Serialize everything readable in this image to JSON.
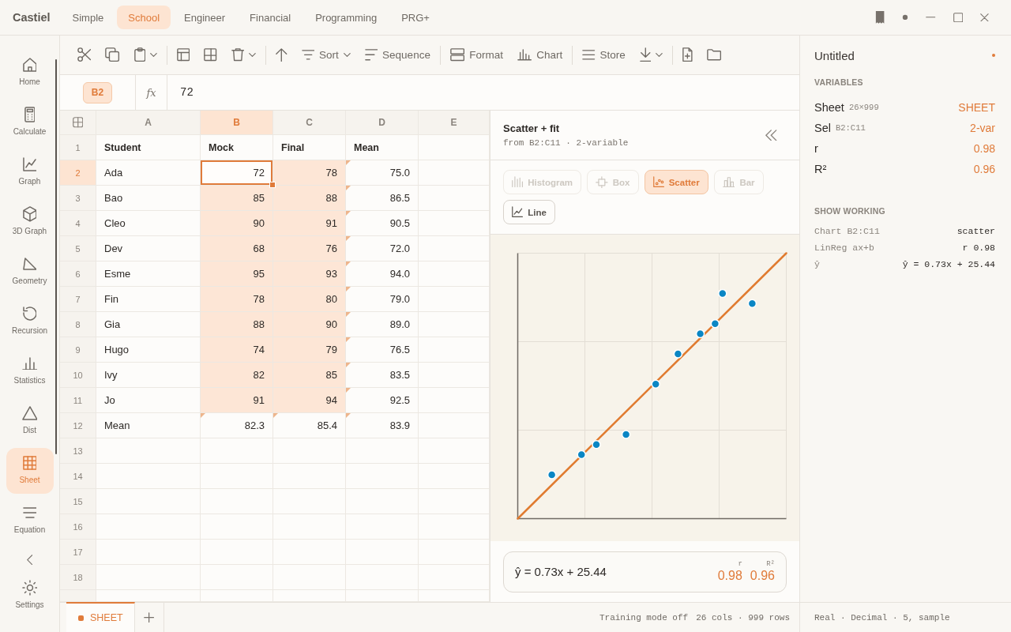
{
  "window": {
    "brand": "Castiel",
    "modes": [
      {
        "label": "Simple",
        "selected": false
      },
      {
        "label": "School",
        "selected": true
      },
      {
        "label": "Engineer",
        "selected": false
      },
      {
        "label": "Financial",
        "selected": false
      },
      {
        "label": "Programming",
        "selected": false
      },
      {
        "label": "PRG+",
        "selected": false
      }
    ]
  },
  "sidebar": {
    "items": [
      {
        "label": "Home",
        "selected": false
      },
      {
        "label": "Calculate",
        "selected": false
      },
      {
        "label": "Graph",
        "selected": false
      },
      {
        "label": "3D Graph",
        "selected": false
      },
      {
        "label": "Geometry",
        "selected": false
      },
      {
        "label": "Recursion",
        "selected": false
      },
      {
        "label": "Statistics",
        "selected": false
      },
      {
        "label": "Dist",
        "selected": false
      },
      {
        "label": "Sheet",
        "selected": true
      },
      {
        "label": "Equation",
        "selected": false
      }
    ],
    "settings": {
      "label": "Settings"
    }
  },
  "toolbar": {
    "groups": [
      [
        {
          "dropdown": false
        },
        {
          "dropdown": false
        },
        {
          "dropdown": true
        }
      ],
      [
        {
          "dropdown": false
        },
        {
          "dropdown": false
        },
        {
          "dropdown": true
        }
      ],
      [
        {
          "dropdown": false
        },
        {
          "label": "Sort",
          "dropdown": true
        },
        {
          "label": "Sequence",
          "dropdown": false
        }
      ],
      [
        {
          "label": "Format",
          "dropdown": false
        },
        {
          "label": "Chart",
          "dropdown": false
        }
      ],
      [
        {
          "label": "Store",
          "dropdown": false
        },
        {
          "dropdown": true
        }
      ],
      [
        {
          "dropdown": false
        },
        {
          "dropdown": false
        }
      ]
    ]
  },
  "formula_bar": {
    "cell": "B2",
    "label": "fx",
    "value": "72"
  },
  "sheet": {
    "columns": [
      {
        "label": "A",
        "selected": false
      },
      {
        "label": "B",
        "selected": true
      },
      {
        "label": "C",
        "selected": false
      },
      {
        "label": "D",
        "selected": false
      },
      {
        "label": "E",
        "selected": false
      }
    ],
    "rows": [
      {
        "label": "1",
        "selected": false,
        "cells": [
          {
            "text": "Student",
            "kind": "heading",
            "selected": false,
            "active": false,
            "formula": false
          },
          {
            "text": "Mock",
            "kind": "heading",
            "selected": false,
            "active": false,
            "formula": false
          },
          {
            "text": "Final",
            "kind": "heading",
            "selected": false,
            "active": false,
            "formula": false
          },
          {
            "text": "Mean",
            "kind": "heading",
            "selected": false,
            "active": false,
            "formula": false
          }
        ]
      },
      {
        "label": "2",
        "selected": true,
        "cells": [
          {
            "text": "Ada",
            "kind": "text",
            "selected": false,
            "active": false,
            "formula": false
          },
          {
            "text": "72",
            "kind": "number",
            "selected": true,
            "active": true,
            "formula": false
          },
          {
            "text": "78",
            "kind": "number",
            "selected": true,
            "active": false,
            "formula": false
          },
          {
            "text": "75.0",
            "kind": "number",
            "selected": false,
            "active": false,
            "formula": true
          }
        ]
      },
      {
        "label": "3",
        "selected": false,
        "cells": [
          {
            "text": "Bao",
            "kind": "text",
            "selected": false,
            "active": false,
            "formula": false
          },
          {
            "text": "85",
            "kind": "number",
            "selected": true,
            "active": false,
            "formula": false
          },
          {
            "text": "88",
            "kind": "number",
            "selected": true,
            "active": false,
            "formula": false
          },
          {
            "text": "86.5",
            "kind": "number",
            "selected": false,
            "active": false,
            "formula": true
          }
        ]
      },
      {
        "label": "4",
        "selected": false,
        "cells": [
          {
            "text": "Cleo",
            "kind": "text",
            "selected": false,
            "active": false,
            "formula": false
          },
          {
            "text": "90",
            "kind": "number",
            "selected": true,
            "active": false,
            "formula": false
          },
          {
            "text": "91",
            "kind": "number",
            "selected": true,
            "active": false,
            "formula": false
          },
          {
            "text": "90.5",
            "kind": "number",
            "selected": false,
            "active": false,
            "formula": true
          }
        ]
      },
      {
        "label": "5",
        "selected": false,
        "cells": [
          {
            "text": "Dev",
            "kind": "text",
            "selected": false,
            "active": false,
            "formula": false
          },
          {
            "text": "68",
            "kind": "number",
            "selected": true,
            "active": false,
            "formula": false
          },
          {
            "text": "76",
            "kind": "number",
            "selected": true,
            "active": false,
            "formula": false
          },
          {
            "text": "72.0",
            "kind": "number",
            "selected": false,
            "active": false,
            "formula": true
          }
        ]
      },
      {
        "label": "6",
        "selected": false,
        "cells": [
          {
            "text": "Esme",
            "kind": "text",
            "selected": false,
            "active": false,
            "formula": false
          },
          {
            "text": "95",
            "kind": "number",
            "selected": true,
            "active": false,
            "formula": false
          },
          {
            "text": "93",
            "kind": "number",
            "selected": true,
            "active": false,
            "formula": false
          },
          {
            "text": "94.0",
            "kind": "number",
            "selected": false,
            "active": false,
            "formula": true
          }
        ]
      },
      {
        "label": "7",
        "selected": false,
        "cells": [
          {
            "text": "Fin",
            "kind": "text",
            "selected": false,
            "active": false,
            "formula": false
          },
          {
            "text": "78",
            "kind": "number",
            "selected": true,
            "active": false,
            "formula": false
          },
          {
            "text": "80",
            "kind": "number",
            "selected": true,
            "active": false,
            "formula": false
          },
          {
            "text": "79.0",
            "kind": "number",
            "selected": false,
            "active": false,
            "formula": true
          }
        ]
      },
      {
        "label": "8",
        "selected": false,
        "cells": [
          {
            "text": "Gia",
            "kind": "text",
            "selected": false,
            "active": false,
            "formula": false
          },
          {
            "text": "88",
            "kind": "number",
            "selected": true,
            "active": false,
            "formula": false
          },
          {
            "text": "90",
            "kind": "number",
            "selected": true,
            "active": false,
            "formula": false
          },
          {
            "text": "89.0",
            "kind": "number",
            "selected": false,
            "active": false,
            "formula": true
          }
        ]
      },
      {
        "label": "9",
        "selected": false,
        "cells": [
          {
            "text": "Hugo",
            "kind": "text",
            "selected": false,
            "active": false,
            "formula": false
          },
          {
            "text": "74",
            "kind": "number",
            "selected": true,
            "active": false,
            "formula": false
          },
          {
            "text": "79",
            "kind": "number",
            "selected": true,
            "active": false,
            "formula": false
          },
          {
            "text": "76.5",
            "kind": "number",
            "selected": false,
            "active": false,
            "formula": true
          }
        ]
      },
      {
        "label": "10",
        "selected": false,
        "cells": [
          {
            "text": "Ivy",
            "kind": "text",
            "selected": false,
            "active": false,
            "formula": false
          },
          {
            "text": "82",
            "kind": "number",
            "selected": true,
            "active": false,
            "formula": false
          },
          {
            "text": "85",
            "kind": "number",
            "selected": true,
            "active": false,
            "formula": false
          },
          {
            "text": "83.5",
            "kind": "number",
            "selected": false,
            "active": false,
            "formula": true
          }
        ]
      },
      {
        "label": "11",
        "selected": false,
        "cells": [
          {
            "text": "Jo",
            "kind": "text",
            "selected": false,
            "active": false,
            "formula": false
          },
          {
            "text": "91",
            "kind": "number",
            "selected": true,
            "active": false,
            "formula": false
          },
          {
            "text": "94",
            "kind": "number",
            "selected": true,
            "active": false,
            "formula": false
          },
          {
            "text": "92.5",
            "kind": "number",
            "selected": false,
            "active": false,
            "formula": true
          }
        ]
      },
      {
        "label": "12",
        "selected": false,
        "cells": [
          {
            "text": "Mean",
            "kind": "text",
            "selected": false,
            "active": false,
            "formula": false
          },
          {
            "text": "82.3",
            "kind": "number",
            "selected": false,
            "active": false,
            "formula": true
          },
          {
            "text": "85.4",
            "kind": "number",
            "selected": false,
            "active": false,
            "formula": true
          },
          {
            "text": "83.9",
            "kind": "number",
            "selected": false,
            "active": false,
            "formula": true
          }
        ]
      },
      {
        "label": "13",
        "selected": false
      },
      {
        "label": "14",
        "selected": false
      },
      {
        "label": "15",
        "selected": false
      },
      {
        "label": "16",
        "selected": false
      },
      {
        "label": "17",
        "selected": false
      },
      {
        "label": "18",
        "selected": false
      }
    ]
  },
  "chart_panel": {
    "title": "Scatter + fit",
    "subtitle": "from B2:C11 · 2-variable",
    "chart_types": [
      {
        "label": "Histogram",
        "selected": false,
        "disabled": true
      },
      {
        "label": "Box",
        "selected": false,
        "disabled": true
      },
      {
        "label": "Scatter",
        "selected": true,
        "disabled": false
      },
      {
        "label": "Bar",
        "selected": false,
        "disabled": true
      },
      {
        "label": "Line",
        "selected": false,
        "disabled": false
      }
    ],
    "result": {
      "equation": "ŷ = 0.73x + 25.44",
      "stats": [
        {
          "label": "r",
          "value": "0.98"
        },
        {
          "label": "R²",
          "value": "0.96"
        }
      ]
    }
  },
  "info_panel": {
    "title": "Untitled",
    "modified": true,
    "sections": [
      {
        "heading": "VARIABLES",
        "kind": "variables",
        "rows": [
          {
            "name": "Sheet",
            "detail": "26×999",
            "value": "SHEET"
          },
          {
            "name": "Sel",
            "detail": "B2:C11",
            "value": "2-var"
          },
          {
            "name": "r",
            "value": "0.98"
          },
          {
            "name": "R²",
            "value": "0.96"
          }
        ]
      },
      {
        "heading": "SHOW WORKING",
        "kind": "working",
        "rows": [
          {
            "name": "Chart B2:C11",
            "value": "scatter"
          },
          {
            "name": "LinReg ax+b",
            "value": "r 0.98"
          },
          {
            "name": "ŷ",
            "value": "ŷ = 0.73x + 25.44"
          }
        ]
      }
    ],
    "status": "Real · Decimal · 5, sample"
  },
  "sheet_tabs": {
    "tabs": [
      {
        "label": "SHEET",
        "selected": true
      }
    ]
  },
  "status_bar": {
    "items": [
      "Training mode off",
      "26 cols · 999 rows"
    ]
  }
}
